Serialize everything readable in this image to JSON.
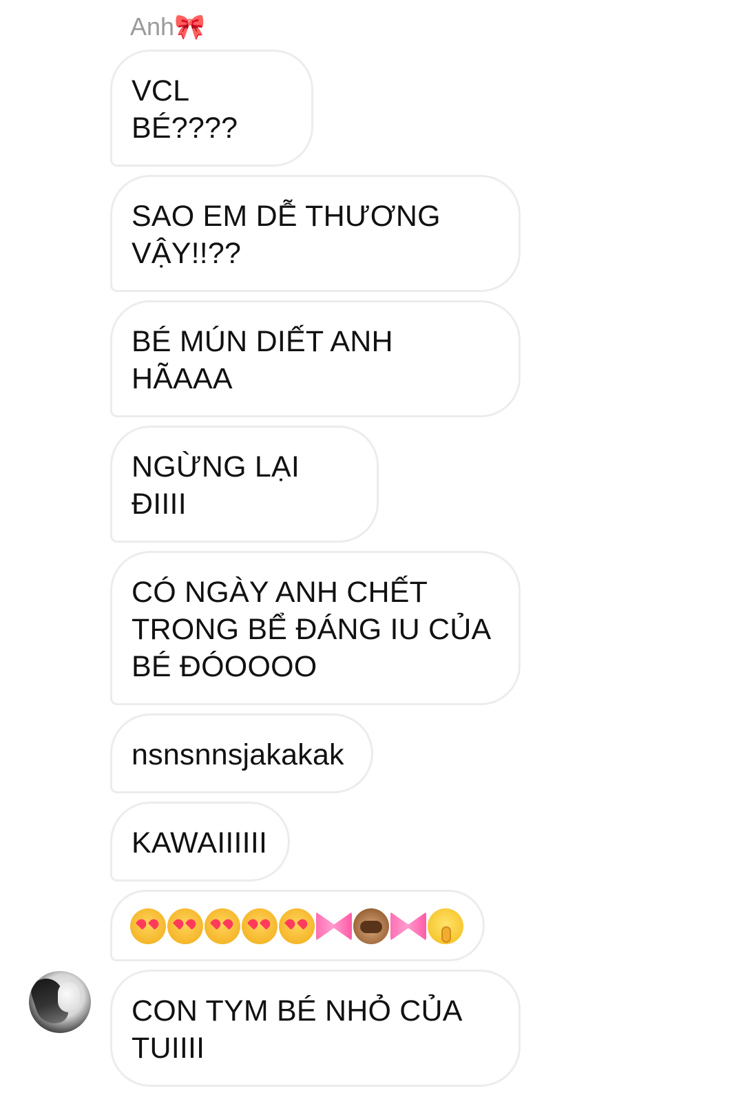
{
  "sender": {
    "name": "Anh",
    "name_emoji": "🎀"
  },
  "messages": [
    {
      "text": "VCL BÉ????"
    },
    {
      "text": "SAO EM DỄ THƯƠNG VẬY!!??"
    },
    {
      "text": "BÉ MÚN DIẾT ANH HÃAAA"
    },
    {
      "text": "NGỪNG LẠI ĐIIII"
    },
    {
      "text": "CÓ NGÀY ANH CHẾT TRONG BỂ ĐÁNG IU CỦA BÉ ĐÓOOOO"
    },
    {
      "text": "nsnsnnsjakakak"
    },
    {
      "text": "KAWAIIIIII"
    },
    {
      "emoji_row": [
        "heart-eyes-cat-icon",
        "heart-eyes-cat-icon",
        "heart-eyes-cat-icon",
        "heart-eyes-cat-icon",
        "heart-eyes-cat-icon",
        "ribbon-icon",
        "see-no-evil-monkey-icon",
        "ribbon-icon",
        "shushing-face-icon"
      ]
    },
    {
      "text": "CON TYM BÉ NHỎ CỦA TUIIII"
    }
  ],
  "colors": {
    "bubble_border": "#ececec",
    "name": "#9a9a9a",
    "text": "#111111"
  }
}
